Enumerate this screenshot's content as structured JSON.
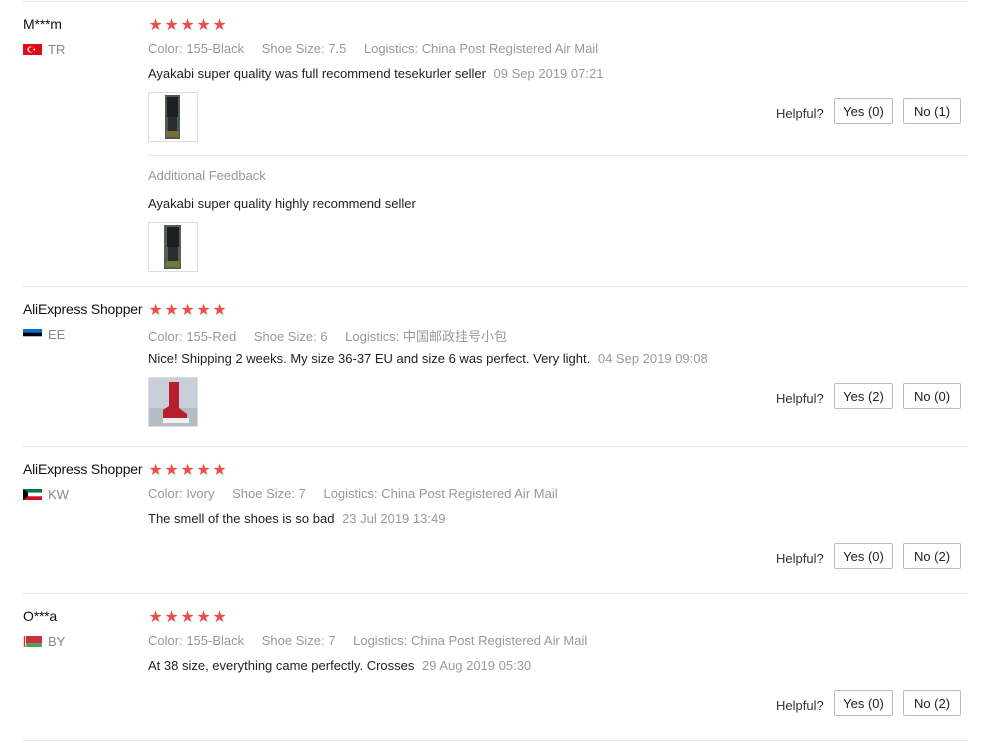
{
  "reviews": [
    {
      "user": "M***m",
      "country": "TR",
      "flag_colors": [
        "#e30a17",
        "#ffffff"
      ],
      "stars": 5,
      "meta": {
        "color_label": "Color:",
        "color_value": "155-Black",
        "size_label": "Shoe Size:",
        "size_value": "7.5",
        "logistics_label": "Logistics:",
        "logistics_value": "China Post Registered Air Mail"
      },
      "text": "Ayakabi super quality was full recommend tesekurler seller",
      "date": "09 Sep 2019 07:21",
      "helpful": "Helpful?",
      "yes": "Yes (0)",
      "no": "No (1)",
      "additional": {
        "title": "Additional Feedback",
        "text": "Ayakabi super quality highly recommend seller"
      }
    },
    {
      "user": "AliExpress Shopper",
      "country": "EE",
      "flag_colors": [
        "#0072ce",
        "#000000",
        "#ffffff"
      ],
      "stars": 5,
      "meta": {
        "color_label": "Color:",
        "color_value": "155-Red",
        "size_label": "Shoe Size:",
        "size_value": "6",
        "logistics_label": "Logistics:",
        "logistics_value": "中国邮政挂号小包"
      },
      "text": "Nice! Shipping 2 weeks. My size 36-37 EU and size 6 was perfect. Very light.",
      "date": "04 Sep 2019 09:08",
      "helpful": "Helpful?",
      "yes": "Yes (2)",
      "no": "No (0)"
    },
    {
      "user": "AliExpress Shopper",
      "country": "KW",
      "flag_colors": [
        "#007a3d",
        "#ffffff",
        "#ce1126",
        "#000000"
      ],
      "stars": 5,
      "meta": {
        "color_label": "Color:",
        "color_value": "Ivory",
        "size_label": "Shoe Size:",
        "size_value": "7",
        "logistics_label": "Logistics:",
        "logistics_value": "China Post Registered Air Mail"
      },
      "text": "The smell of the shoes is so bad",
      "date": "23 Jul 2019 13:49",
      "helpful": "Helpful?",
      "yes": "Yes (0)",
      "no": "No (2)"
    },
    {
      "user": "O***a",
      "country": "BY",
      "flag_colors": [
        "#c8313e",
        "#4aa657",
        "#ffffff"
      ],
      "stars": 5,
      "meta": {
        "color_label": "Color:",
        "color_value": "155-Black",
        "size_label": "Shoe Size:",
        "size_value": "7",
        "logistics_label": "Logistics:",
        "logistics_value": "China Post Registered Air Mail"
      },
      "text": "At 38 size, everything came perfectly. Crosses",
      "date": "29 Aug 2019 05:30",
      "helpful": "Helpful?",
      "yes": "Yes (0)",
      "no": "No (2)"
    }
  ],
  "icons": {
    "star": "star-icon"
  },
  "colors": {
    "star": "#ee4d4d",
    "muted": "#999999",
    "divider": "#e6e6e6"
  }
}
